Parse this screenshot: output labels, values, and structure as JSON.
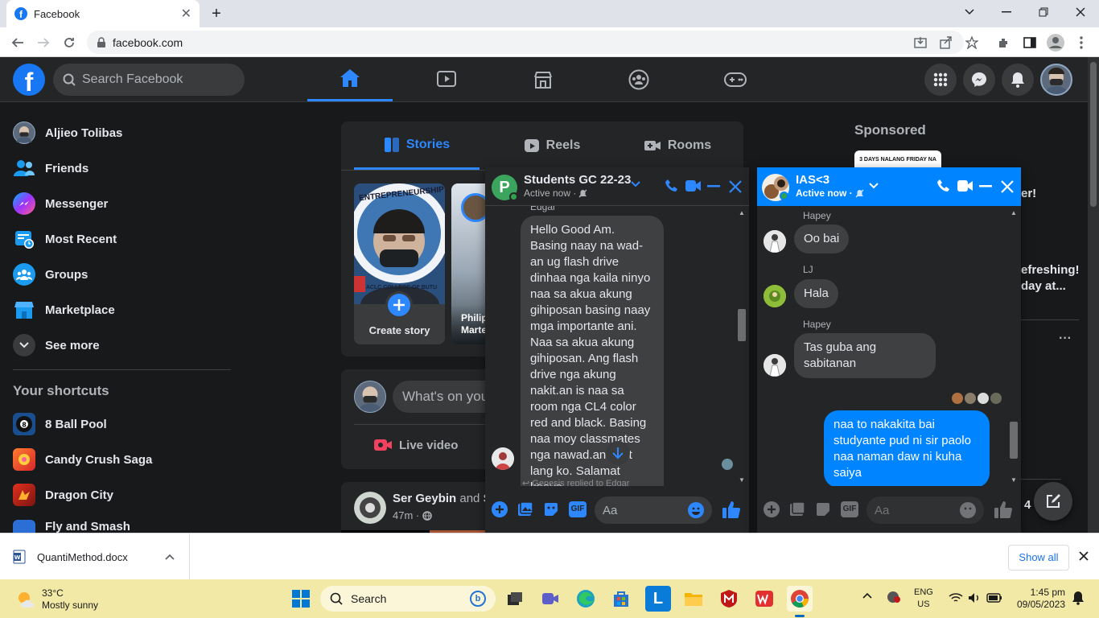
{
  "browser": {
    "tab_title": "Facebook",
    "url": "facebook.com"
  },
  "header": {
    "search_placeholder": "Search Facebook"
  },
  "sidebar": {
    "items": [
      {
        "label": "Aljieo Tolibas",
        "icon": "profile-avatar"
      },
      {
        "label": "Friends",
        "icon": "friends-icon"
      },
      {
        "label": "Messenger",
        "icon": "messenger-icon"
      },
      {
        "label": "Most Recent",
        "icon": "feed-icon"
      },
      {
        "label": "Groups",
        "icon": "groups-icon"
      },
      {
        "label": "Marketplace",
        "icon": "marketplace-icon"
      },
      {
        "label": "See more",
        "icon": "chevron-down-icon"
      }
    ],
    "shortcuts_title": "Your shortcuts",
    "shortcuts": [
      "8 Ball Pool",
      "Candy Crush Saga",
      "Dragon City",
      "Fly and Smash"
    ]
  },
  "stories": {
    "tabs": [
      "Stories",
      "Reels",
      "Rooms"
    ],
    "create_label": "Create story",
    "story_name": "Philip Marte",
    "story_logo_text": "ENTREPRENEURSHIP",
    "story_logo_bottom": "ACLC COLLEGE OF BUTU"
  },
  "composer": {
    "placeholder": "What's on you",
    "live_label": "Live video"
  },
  "post": {
    "author": "Ser Geybin",
    "and": "and",
    "tail": "S",
    "time": "47m ·"
  },
  "right": {
    "sponsored": "Sponsored",
    "ad_text": "3 DAYS NALANG FRIDAY NA",
    "frag1": "er!",
    "frag2": "efreshing!",
    "frag3": "day at...",
    "more": "···",
    "count": "4"
  },
  "chat1": {
    "title": "Students GC 22-23",
    "status": "Active now ·",
    "sender_top": "Edgar",
    "message": "Hello Good Am. Basing naay na wad-an ug flash drive dinhaa nga kaila ninyo naa sa akua akung gihiposan basing naay mga importante ani. Naa sa akua akung gihiposan. Ang flash drive nga akung nakit.an is naa sa room nga CL4 color red and black. Basing naa moy classmates nga nawad.an chat lang ko. Salamat kaayo",
    "reply_note": "Genesis replied to Edgar",
    "input_placeholder": "Aa"
  },
  "chat2": {
    "title": "IAS<3",
    "status": "Active now ·",
    "messages": [
      {
        "sender": "Hapey",
        "text": "Oo bai"
      },
      {
        "sender": "LJ",
        "text": "Hala"
      },
      {
        "sender": "Hapey",
        "text": "Tas guba ang sabitanan"
      }
    ],
    "own_message": "naa to nakakita bai studyante pud ni sir paolo naa naman daw ni kuha saiya",
    "input_placeholder": "Aa"
  },
  "download": {
    "file": "QuantiMethod.docx",
    "show_all": "Show all"
  },
  "taskbar": {
    "temp": "33°C",
    "weather": "Mostly sunny",
    "search": "Search",
    "lang1": "ENG",
    "lang2": "US",
    "time": "1:45 pm",
    "date": "09/05/2023"
  },
  "colors": {
    "accent": "#1877f2",
    "fb_bg": "#18191a",
    "surface": "#242526"
  }
}
